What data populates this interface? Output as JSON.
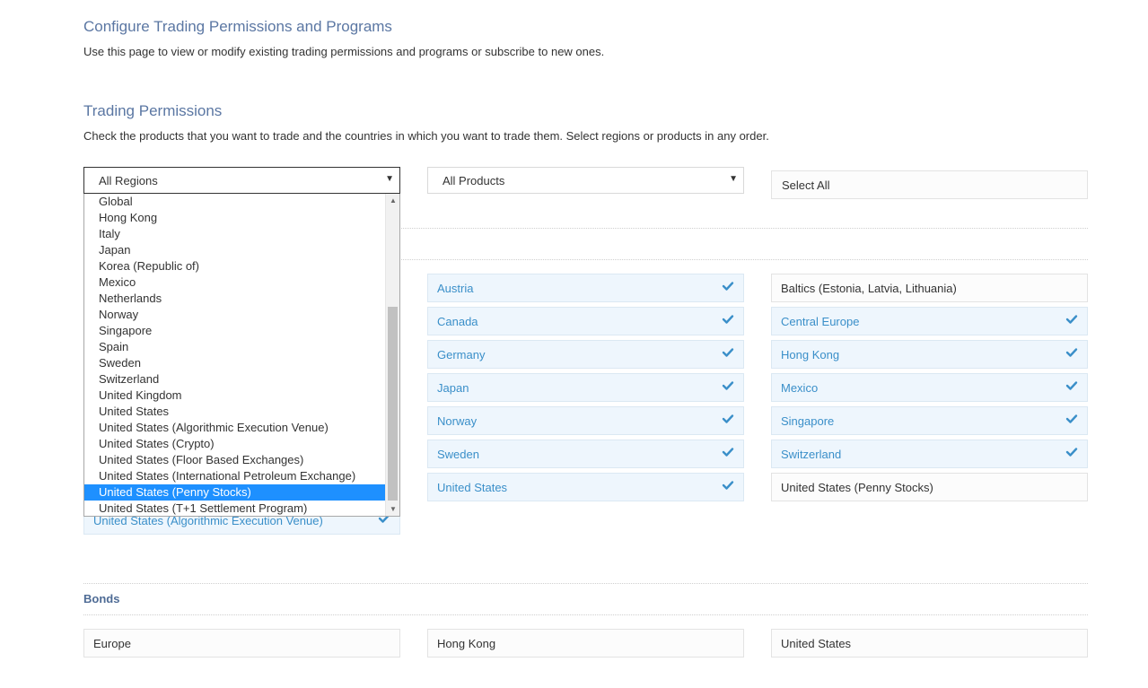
{
  "header": {
    "title": "Configure Trading Permissions and Programs",
    "subtitle": "Use this page to view or modify existing trading permissions and programs or subscribe to new ones."
  },
  "permissions": {
    "title": "Trading Permissions",
    "subtitle": "Check the products that you want to trade and the countries in which you want to trade them. Select regions or products in any order."
  },
  "filters": {
    "regions_selected": "All Regions",
    "products_selected": "All Products",
    "select_all_label": "Select All"
  },
  "region_dropdown": {
    "options": [
      "Global",
      "Hong Kong",
      "Italy",
      "Japan",
      "Korea (Republic of)",
      "Mexico",
      "Netherlands",
      "Norway",
      "Singapore",
      "Spain",
      "Sweden",
      "Switzerland",
      "United Kingdom",
      "United States",
      "United States (Algorithmic Execution Venue)",
      "United States (Crypto)",
      "United States (Floor Based Exchanges)",
      "United States (International Petroleum Exchange)",
      "United States (Penny Stocks)",
      "United States (T+1 Settlement Program)"
    ],
    "highlighted": "United States (Penny Stocks)"
  },
  "stocks": {
    "col1_partial": "United States (Algorithmic Execution Venue)",
    "col2": [
      {
        "label": "Austria",
        "selected": true
      },
      {
        "label": "Canada",
        "selected": true
      },
      {
        "label": "Germany",
        "selected": true
      },
      {
        "label": "Japan",
        "selected": true
      },
      {
        "label": "Norway",
        "selected": true
      },
      {
        "label": "Sweden",
        "selected": true
      },
      {
        "label": "United States",
        "selected": true
      }
    ],
    "col3": [
      {
        "label": "Baltics (Estonia, Latvia, Lithuania)",
        "selected": false
      },
      {
        "label": "Central Europe",
        "selected": true
      },
      {
        "label": "Hong Kong",
        "selected": true
      },
      {
        "label": "Mexico",
        "selected": true
      },
      {
        "label": "Singapore",
        "selected": true
      },
      {
        "label": "Switzerland",
        "selected": true
      },
      {
        "label": "United States (Penny Stocks)",
        "selected": false
      }
    ]
  },
  "bonds": {
    "title": "Bonds",
    "items": [
      {
        "label": "Europe",
        "selected": false
      },
      {
        "label": "Hong Kong",
        "selected": false
      },
      {
        "label": "United States",
        "selected": false
      }
    ]
  },
  "colors": {
    "title": "#5b77a3",
    "selected_text": "#3a8fc9",
    "selected_bg": "#eef6fd",
    "highlight": "#1e90ff"
  }
}
